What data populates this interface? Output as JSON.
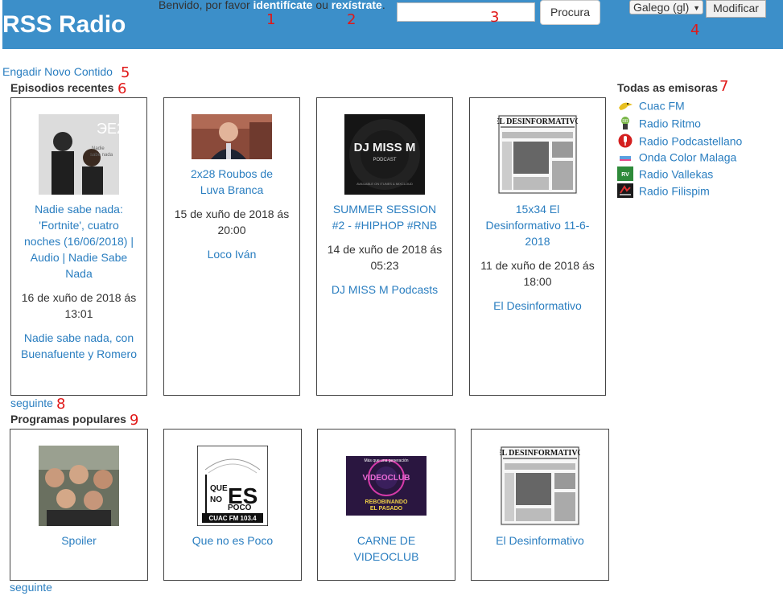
{
  "header": {
    "site_title": "RSS Radio",
    "welcome_prefix": "Benvido, por favor",
    "login_link": "identifícate",
    "welcome_or": "ou",
    "register_link": "rexístrate",
    "welcome_suffix": ".",
    "search_value": "",
    "search_button": "Procura",
    "language_selected": "Galego (gl)",
    "modify_button": "Modificar"
  },
  "add_content_link": "Engadir Novo Contido",
  "recent": {
    "title": "Episodios recentes",
    "more": "seguinte",
    "items": [
      {
        "title": "Nadie sabe nada: 'Fortnite', cuatro noches (16/06/2018) | Audio | Nadie Sabe Nada",
        "date": "16 de xuño de 2018 ás 13:01",
        "show": "Nadie sabe nada, con Buenafuente y Romero",
        "image": "nadie-sabe-nada-cover"
      },
      {
        "title": "2x28 Roubos de Luva Branca",
        "date": "15 de xuño de 2018 ás 20:00",
        "show": "Loco Iván",
        "image": "man-in-suit-photo"
      },
      {
        "title": "SUMMER SESSION #2 - #HIPHOP #RNB",
        "date": "14 de xuño de 2018 ás 05:23",
        "show": "DJ MISS M Podcasts",
        "image": "dj-miss-m-cover"
      },
      {
        "title": "15x34 El Desinformativo 11-6-2018",
        "date": "11 de xuño de 2018 ás 18:00",
        "show": "El Desinformativo",
        "image": "el-desinformativo-cover"
      }
    ]
  },
  "popular": {
    "title": "Programas populares",
    "more": "seguinte",
    "items": [
      {
        "title": "Spoiler",
        "image": "group-selfie-photo"
      },
      {
        "title": "Que no es Poco",
        "image": "que-no-es-poco-logo"
      },
      {
        "title": "CARNE DE VIDEOCLUB",
        "image": "carne-de-videoclub-cover"
      },
      {
        "title": "El Desinformativo",
        "image": "el-desinformativo-cover"
      }
    ]
  },
  "stations": {
    "title": "Todas as emisoras",
    "items": [
      {
        "name": "Cuac FM",
        "icon": "cuac-fm-icon"
      },
      {
        "name": "Radio Ritmo",
        "icon": "radio-ritmo-icon"
      },
      {
        "name": "Radio Podcastellano",
        "icon": "podcastellano-icon"
      },
      {
        "name": "Onda Color Malaga",
        "icon": "onda-color-icon"
      },
      {
        "name": "Radio Vallekas",
        "icon": "radio-vallekas-icon"
      },
      {
        "name": "Radio Filispim",
        "icon": "radio-filispim-icon"
      }
    ]
  },
  "markers": [
    "1",
    "2",
    "3",
    "4",
    "5",
    "6",
    "7",
    "8",
    "9"
  ],
  "colors": {
    "header": "#3c8fc9",
    "link": "#2a7ec0",
    "marker": "#e01818"
  }
}
